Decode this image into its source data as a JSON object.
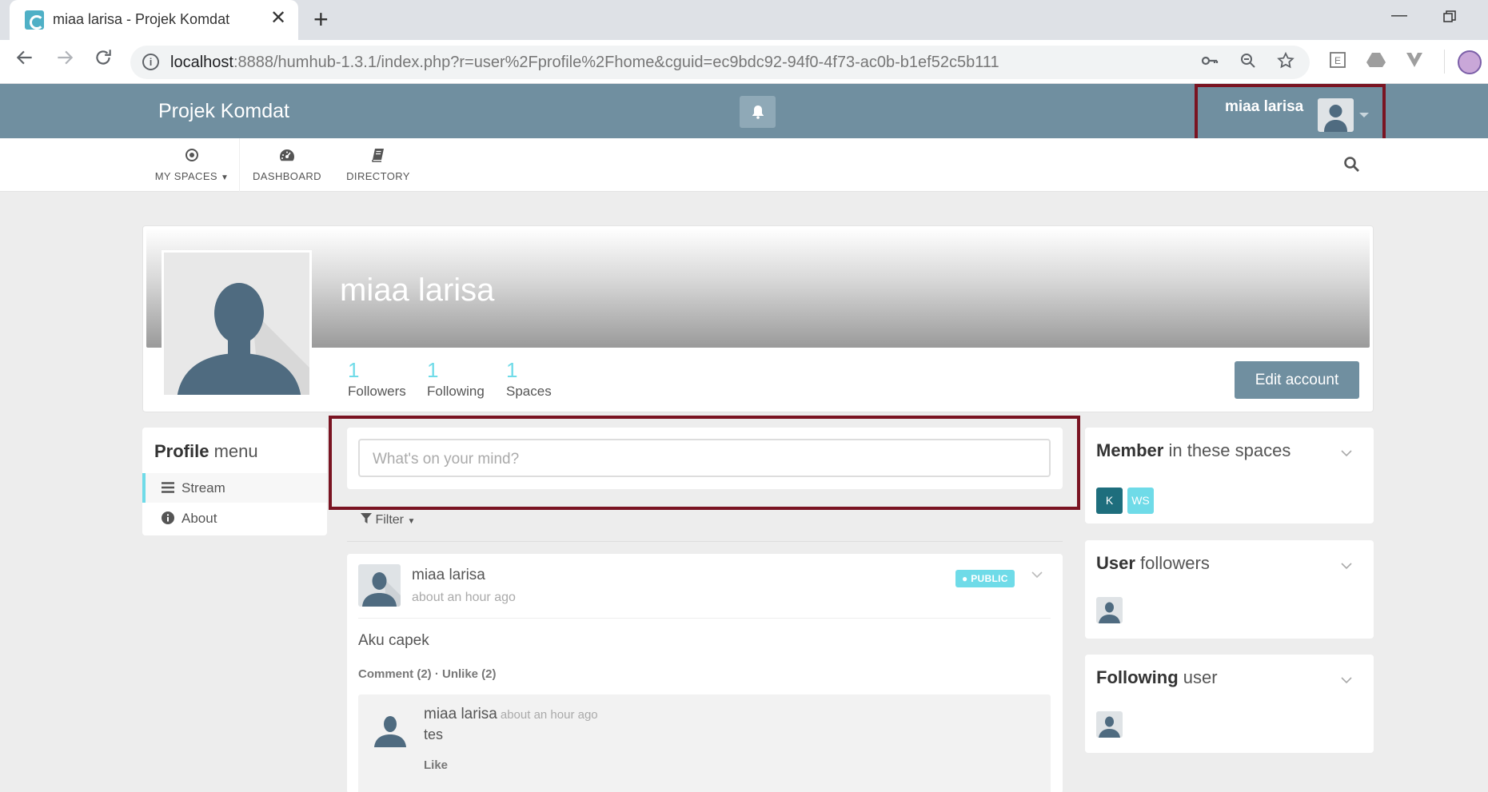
{
  "browser": {
    "tab_title": "miaa larisa - Projek Komdat",
    "tab_close": "✕",
    "new_tab": "+",
    "url_host": "localhost",
    "url_rest": ":8888/humhub-1.3.1/index.php?r=user%2Fprofile%2Fhome&cguid=ec9bdc92-94f0-4f73-ac0b-b1ef52c5b111",
    "icons": [
      "back-icon",
      "forward-icon",
      "reload-icon",
      "info-icon",
      "key-icon",
      "zoom-icon",
      "star-icon",
      "extension-e-icon",
      "drive-icon",
      "vivaldi-icon",
      "profile-icon"
    ]
  },
  "topbar": {
    "brand": "Projek Komdat",
    "user_name": "miaa larisa",
    "accent_color": "#708fa0",
    "highlight_color": "#7a1422"
  },
  "nav": {
    "items": [
      {
        "label": "MY SPACES",
        "icon": "dot-circle-icon"
      },
      {
        "label": "DASHBOARD",
        "icon": "dashboard-icon"
      },
      {
        "label": "DIRECTORY",
        "icon": "book-icon"
      }
    ]
  },
  "profile": {
    "name": "miaa larisa",
    "stats": [
      {
        "value": "1",
        "label": "Followers"
      },
      {
        "value": "1",
        "label": "Following"
      },
      {
        "value": "1",
        "label": "Spaces"
      }
    ],
    "edit_label": "Edit account"
  },
  "profile_menu": {
    "title_bold": "Profile",
    "title_rest": " menu",
    "items": [
      {
        "label": "Stream",
        "icon": "bars-icon",
        "active": true
      },
      {
        "label": "About",
        "icon": "info-circle-icon",
        "active": false
      }
    ]
  },
  "stream": {
    "placeholder": "What's on your mind?",
    "filter_label": "Filter",
    "post": {
      "author": "miaa larisa",
      "time": "about an hour ago",
      "visibility": "PUBLIC",
      "text": "Aku capek",
      "actions": "Comment (2) ·  Unlike (2)",
      "comment": {
        "author": "miaa larisa",
        "time": "about an hour ago",
        "text": "tes",
        "like": "Like"
      }
    }
  },
  "sidebar": {
    "member": {
      "title_bold": "Member",
      "title_rest": " in these spaces",
      "spaces": [
        {
          "label": "K",
          "color": "#1e6e7d"
        },
        {
          "label": "WS",
          "color": "#6fdbe8"
        }
      ]
    },
    "followers": {
      "title_bold": "User",
      "title_rest": " followers"
    },
    "following": {
      "title_bold": "Following",
      "title_rest": " user"
    }
  }
}
